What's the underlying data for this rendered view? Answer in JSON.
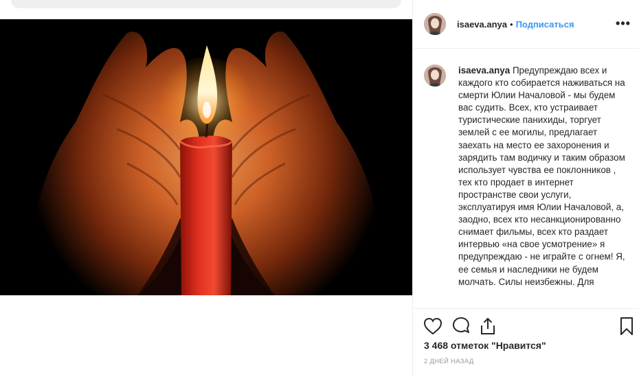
{
  "post": {
    "username": "isaeva.anya",
    "separator": "•",
    "follow_label": "Подписаться",
    "more_label": "•••"
  },
  "caption": {
    "username": "isaeva.anya",
    "text": "Предупреждаю всех и каждого кто собирается наживаться на смерти Юлии Началовой - мы будем вас судить. Всех, кто устраивает туристические панихиды, торгует землей с ее могилы, предлагает заехать на место ее захоронения и зарядить там водичку и таким образом использует чувства ее поклонников , тех кто продает в интернет пространстве свои услуги, эксплуатируя имя Юлии Началовой, а, заодно, всех кто несанкционированно снимает фильмы, всех кто раздает интервью «на свое усмотрение» я предупреждаю - не играйте с огнем! Я, ее семья и наследники не будем молчать. Силы неизбежны. Для"
  },
  "actions": {
    "like_icon": "heart-icon",
    "comment_icon": "comment-icon",
    "share_icon": "share-icon",
    "save_icon": "bookmark-icon"
  },
  "likes_text": "3 468 отметок \"Нравится\"",
  "date_text": "2 ДНЕЙ НАЗАД",
  "image": {
    "subject": "candle-in-hands",
    "colors": {
      "background": "#000000",
      "candle": "#d8281c",
      "flame": "#fff6c8",
      "hands": "#c9531c"
    }
  }
}
